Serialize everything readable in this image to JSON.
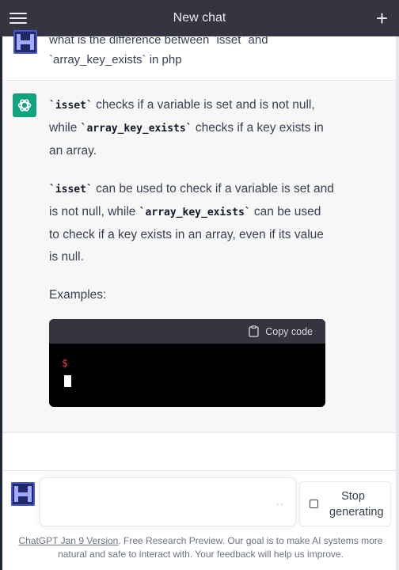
{
  "header": {
    "title": "New chat",
    "plus": "+"
  },
  "user_message": {
    "line1": "what is the difference between `isset` and",
    "line2": "`array_key_exists` in php"
  },
  "assistant_message": {
    "p1": {
      "code1": "`isset`",
      "t1": " checks if a variable is set and is not null, while ",
      "code2": "`array_key_exists`",
      "t2": " checks if a key exists in an array."
    },
    "p2": {
      "code1": "`isset`",
      "t1": " can be used to check if a variable is set and is not null, while ",
      "code2": "`array_key_exists`",
      "t2": " can be used to check if a key exists in an array, even if its value is null."
    },
    "p3": "Examples:",
    "code_block": {
      "copy_label": "Copy code",
      "prompt": "$"
    }
  },
  "composer": {
    "input_value": "",
    "input_placeholder": "",
    "send_indicator": "··",
    "stop_label": "Stop generating"
  },
  "footer": {
    "link_text": "ChatGPT Jan 9 Version",
    "text": ". Free Research Preview. Our goal is to make AI systems more natural and safe to interact with. Your feedback will help us improve."
  },
  "colors": {
    "header_bg": "#343541",
    "assistant_bg": "#f7f7f8",
    "gpt_green": "#10a37f",
    "code_bg": "#000000",
    "prompt_red": "#ef4146"
  }
}
